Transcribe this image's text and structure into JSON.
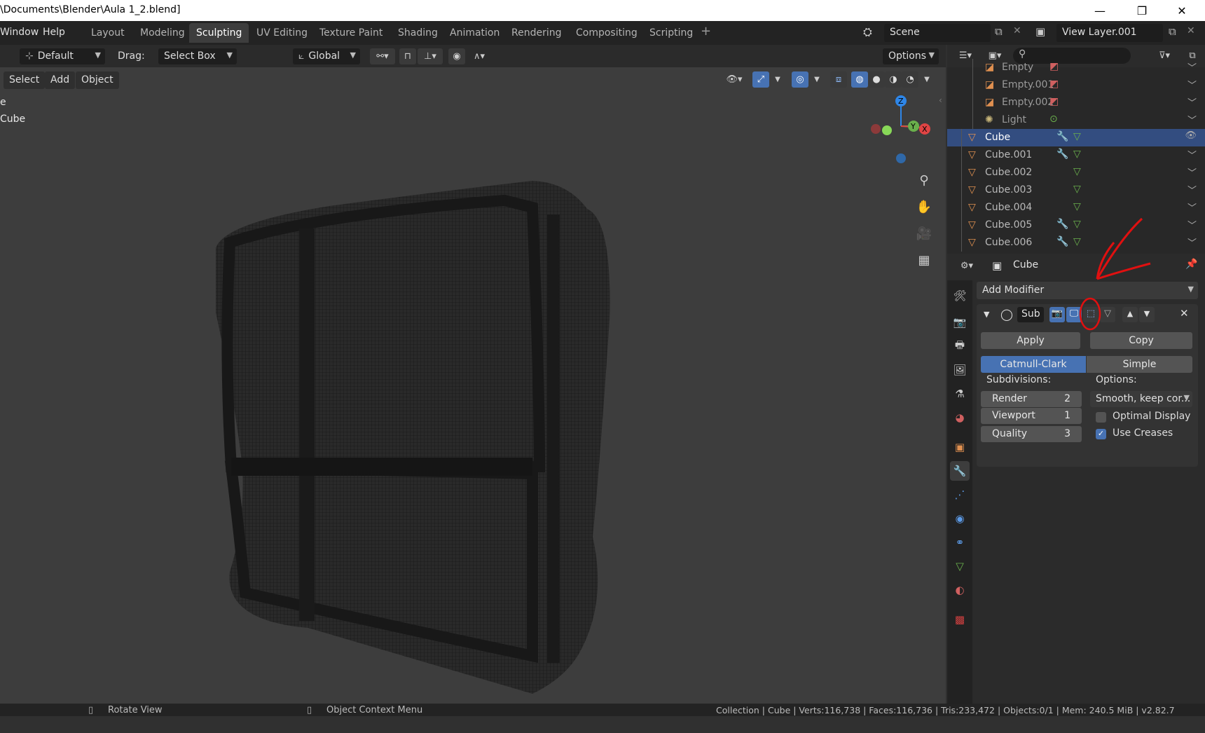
{
  "window": {
    "title": "\\Documents\\Blender\\Aula 1_2.blend]",
    "minimize": "—",
    "restore": "❐",
    "close": "✕"
  },
  "menu": {
    "window": "Window",
    "help": "Help"
  },
  "workspace_tabs": [
    "Layout",
    "Modeling",
    "Sculpting",
    "UV Editing",
    "Texture Paint",
    "Shading",
    "Animation",
    "Rendering",
    "Compositing",
    "Scripting"
  ],
  "workspace_add": "+",
  "scene": {
    "name": "Scene"
  },
  "view_layer": {
    "name": "View Layer.001"
  },
  "tool_header": {
    "orientation": "Default",
    "drag_label": "Drag:",
    "drag_value": "Select Box",
    "transform": "Global",
    "options": "Options"
  },
  "viewport_menu": {
    "select": "Select",
    "add": "Add",
    "object": "Object"
  },
  "viewport_overlay_text": {
    "line1": "e",
    "line2": "Cube"
  },
  "gizmo": {
    "z": "Z",
    "y": "Y",
    "x": "X"
  },
  "outliner": {
    "items": [
      {
        "name": "Empty",
        "type": "empty"
      },
      {
        "name": "Empty.001",
        "type": "empty"
      },
      {
        "name": "Empty.002",
        "type": "empty"
      },
      {
        "name": "Light",
        "type": "light"
      },
      {
        "name": "Cube",
        "type": "mesh",
        "active": true
      },
      {
        "name": "Cube.001",
        "type": "mesh"
      },
      {
        "name": "Cube.002",
        "type": "mesh"
      },
      {
        "name": "Cube.003",
        "type": "mesh"
      },
      {
        "name": "Cube.004",
        "type": "mesh"
      },
      {
        "name": "Cube.005",
        "type": "mesh"
      },
      {
        "name": "Cube.006",
        "type": "mesh"
      }
    ]
  },
  "properties": {
    "object_name": "Cube",
    "add_modifier": "Add Modifier",
    "modifier": {
      "name": "Sub",
      "apply": "Apply",
      "copy": "Copy",
      "algorithm_catmull": "Catmull-Clark",
      "algorithm_simple": "Simple",
      "subdivisions_label": "Subdivisions:",
      "options_label": "Options:",
      "render_label": "Render",
      "render_value": "2",
      "viewport_label": "Viewport",
      "viewport_value": "1",
      "quality_label": "Quality",
      "quality_value": "3",
      "uv_smooth": "Smooth, keep cor...",
      "optimal_display": "Optimal Display",
      "use_creases": "Use Creases",
      "optimal_display_checked": false,
      "use_creases_checked": true
    }
  },
  "status_bar": {
    "rotate_view": "Rotate View",
    "context_menu": "Object Context Menu",
    "stats": "Collection | Cube | Verts:116,738 | Faces:116,736 | Tris:233,472 | Objects:0/1 | Mem: 240.5 MiB | v2.82.7"
  },
  "colors": {
    "accent": "#4772b3",
    "annotation": "#e01010",
    "mesh_icon": "#e09050",
    "data_icon": "#6ab04c"
  }
}
